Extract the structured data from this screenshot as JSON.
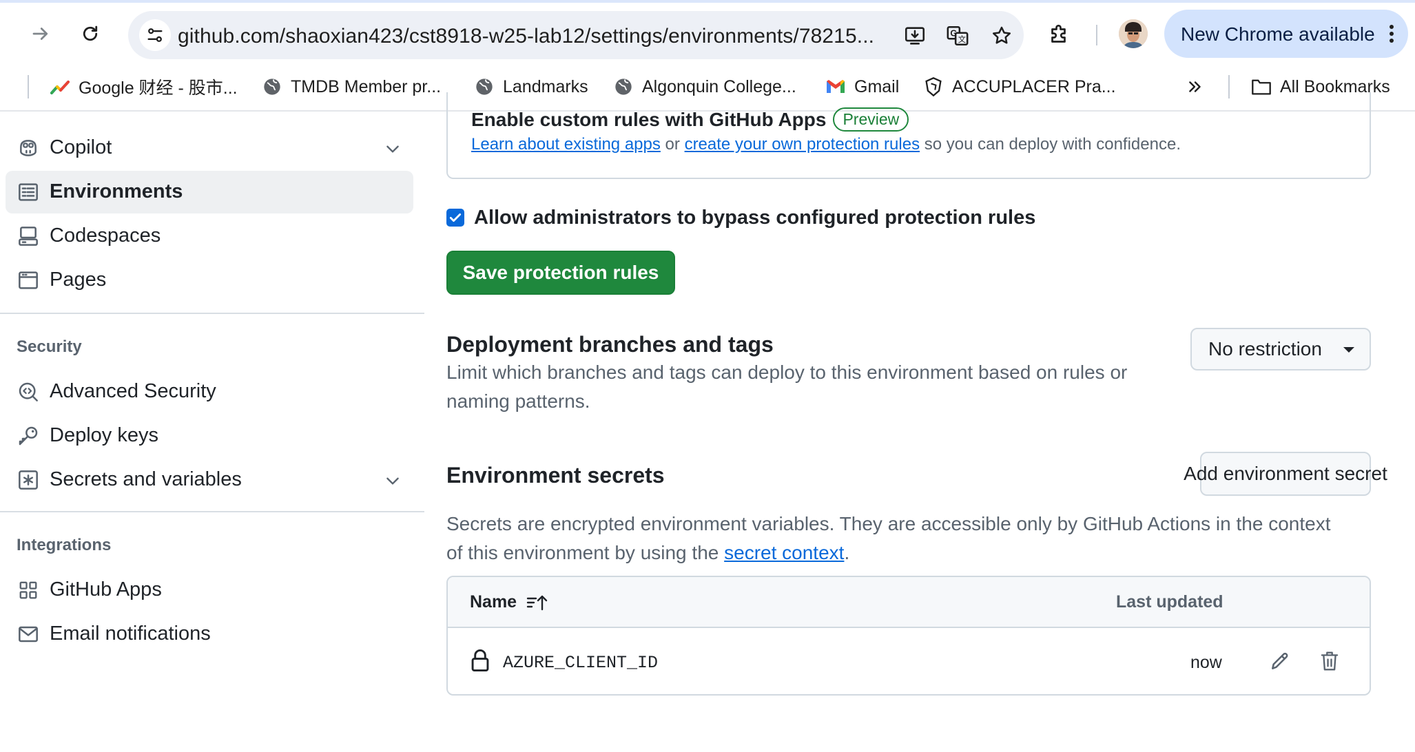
{
  "browser": {
    "url": "github.com/shaoxian423/cst8918-w25-lab12/settings/environments/78215...",
    "update_pill": "New Chrome available"
  },
  "bookmarks": [
    {
      "label": "Google 财经 - 股市...",
      "icon": "google-finance-icon"
    },
    {
      "label": "TMDB Member pr...",
      "icon": "globe-icon"
    },
    {
      "label": "Landmarks",
      "icon": "globe-icon"
    },
    {
      "label": "Algonquin College...",
      "icon": "globe-icon"
    },
    {
      "label": "Gmail",
      "icon": "gmail-icon"
    },
    {
      "label": "ACCUPLACER Pra...",
      "icon": "accuplacer-icon"
    }
  ],
  "all_bookmarks": "All Bookmarks",
  "sidebar": {
    "items_top": [
      {
        "label": "Copilot",
        "icon": "copilot-icon"
      },
      {
        "label": "Environments",
        "icon": "environments-icon"
      },
      {
        "label": "Codespaces",
        "icon": "codespaces-icon"
      },
      {
        "label": "Pages",
        "icon": "pages-icon"
      }
    ],
    "security_heading": "Security",
    "security_items": [
      {
        "label": "Advanced Security",
        "icon": "codescan-icon"
      },
      {
        "label": "Deploy keys",
        "icon": "key-icon"
      },
      {
        "label": "Secrets and variables",
        "icon": "asterisk-icon"
      }
    ],
    "integrations_heading": "Integrations",
    "integrations_items": [
      {
        "label": "GitHub Apps",
        "icon": "apps-icon"
      },
      {
        "label": "Email notifications",
        "icon": "mail-icon"
      }
    ]
  },
  "custom_rules": {
    "title": "Enable custom rules with GitHub Apps",
    "badge": "Preview",
    "link1": "Learn about existing apps",
    "mid": " or ",
    "link2": "create your own protection rules",
    "tail": " so you can deploy with confidence."
  },
  "bypass": {
    "label": "Allow administrators to bypass configured protection rules",
    "checked": true
  },
  "save_button": "Save protection rules",
  "deployment": {
    "title": "Deployment branches and tags",
    "desc_line1": "Limit which branches and tags can deploy to this environment based on rules or",
    "desc_line2": "naming patterns.",
    "dropdown": "No restriction"
  },
  "secrets": {
    "title": "Environment secrets",
    "add_button": "Add environment secret",
    "desc_line1": "Secrets are encrypted environment variables. They are accessible only by GitHub Actions in the context",
    "desc_pre": "of this environment by using the ",
    "desc_link": "secret context",
    "desc_post": ".",
    "col_name": "Name",
    "col_updated": "Last updated",
    "rows": [
      {
        "name": "AZURE_CLIENT_ID",
        "updated": "now"
      }
    ]
  },
  "colors": {
    "primary_button": "#1f883d",
    "link": "#0969da",
    "chrome_pill": "#d3e3fd"
  }
}
